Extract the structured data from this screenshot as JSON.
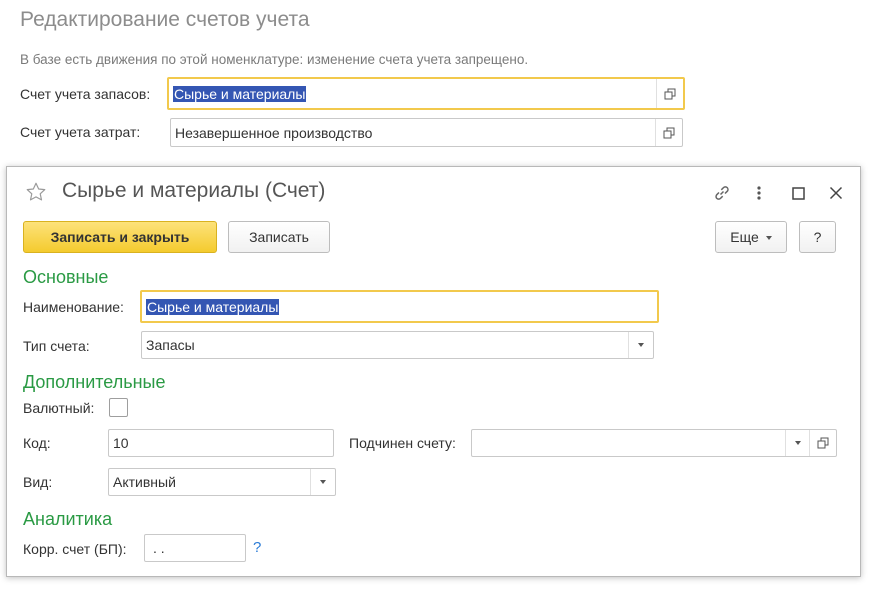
{
  "background_form": {
    "title": "Редактирование счетов учета",
    "info": "В базе есть движения по этой номенклатуре: изменение счета учета запрещено.",
    "fields": [
      {
        "label": "Счет учета запасов:",
        "value": "Сырье и материалы"
      },
      {
        "label": "Счет учета затрат:",
        "value": "Незавершенное производство"
      }
    ]
  },
  "dialog": {
    "title": "Сырье и материалы (Счет)",
    "toolbar": {
      "save_close_label": "Записать и закрыть",
      "save_label": "Записать",
      "more_label": "Еще",
      "help_label": "?"
    },
    "sections": {
      "main": "Основные",
      "additional": "Дополнительные",
      "analytics": "Аналитика"
    },
    "fields": {
      "name_label": "Наименование:",
      "name_value": "Сырье и материалы",
      "type_label": "Тип счета:",
      "type_value": "Запасы",
      "currency_label": "Валютный:",
      "currency_checked": false,
      "code_label": "Код:",
      "code_value": "10",
      "parent_label": "Подчинен счету:",
      "parent_value": "",
      "kind_label": "Вид:",
      "kind_value": "Активный",
      "corr_label": "Корр. счет (БП):",
      "corr_value": " .  .",
      "corr_help": "?"
    }
  },
  "colors": {
    "accent_green": "#2a9a44",
    "primary_button": "#fad543",
    "focus_border": "#f2c94c",
    "selection": "#3456b3"
  }
}
